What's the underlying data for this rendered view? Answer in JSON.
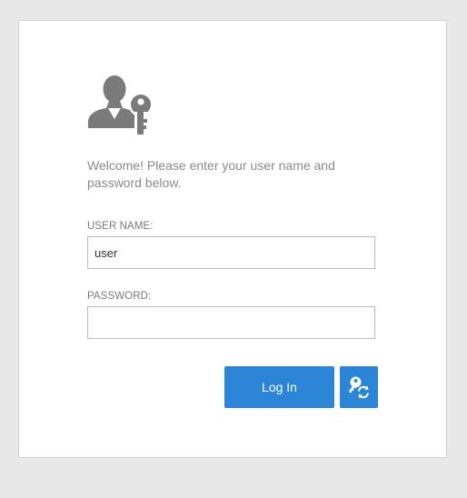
{
  "login": {
    "welcome_text": "Welcome! Please enter your user name and password below.",
    "username_label": "USER NAME:",
    "username_value": "user",
    "password_label": "PASSWORD:",
    "password_value": "",
    "login_button_label": "Log In",
    "logo_icon": "user-key-icon",
    "reset_icon": "key-refresh-icon"
  },
  "colors": {
    "page_background": "#e8e8e8",
    "card_background": "#ffffff",
    "accent": "#2b84d6",
    "icon_gray": "#7a7a7a",
    "text_gray": "#8a8a8a"
  }
}
